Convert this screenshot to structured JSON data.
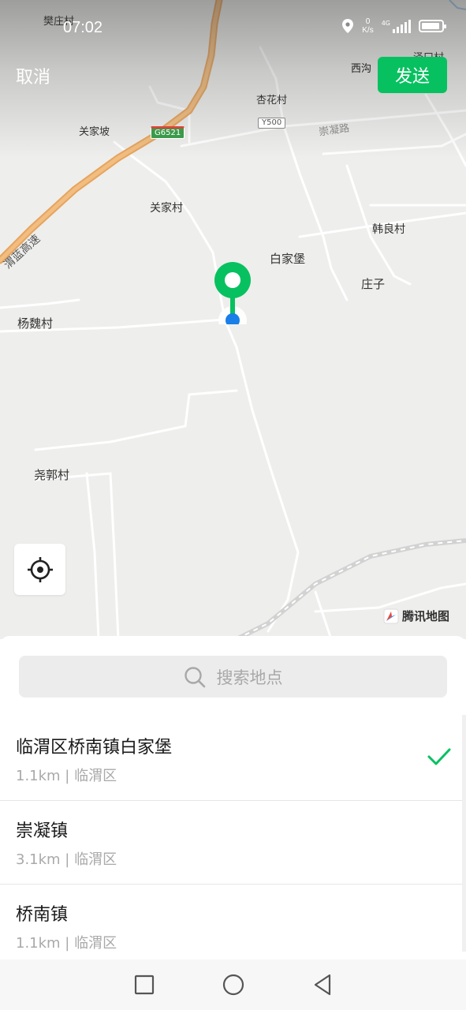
{
  "status_bar": {
    "time": "07:02",
    "net_speed_value": "0",
    "net_speed_unit": "K/s",
    "network_type": "4G",
    "battery_percent": 90
  },
  "header": {
    "cancel_label": "取消",
    "send_label": "发送"
  },
  "map": {
    "places": {
      "fanzhuang": "樊庄村",
      "xigou": "西沟",
      "zekou": "泽口村",
      "xinghua": "杏花村",
      "guanjiapo": "关家坡",
      "guanjiacun": "关家村",
      "hanliang": "韩良村",
      "baijiapu": "白家堡",
      "zhuangzi": "庄子",
      "yangwei": "杨魏村",
      "yaoguo": "尧郭村"
    },
    "roads": {
      "chongning_road": "崇凝路",
      "expressway": "渭蓝高速",
      "shield_g": "G6521",
      "shield_y": "Y500"
    },
    "brand": "腾讯地图",
    "accent_color": "#07c160",
    "user_dot_color": "#1a7ee8"
  },
  "search": {
    "placeholder": "搜索地点"
  },
  "results": [
    {
      "title": "临渭区桥南镇白家堡",
      "subtitle": "1.1km | 临渭区",
      "selected": true
    },
    {
      "title": "崇凝镇",
      "subtitle": "3.1km | 临渭区",
      "selected": false
    },
    {
      "title": "桥南镇",
      "subtitle": "1.1km | 临渭区",
      "selected": false
    }
  ]
}
